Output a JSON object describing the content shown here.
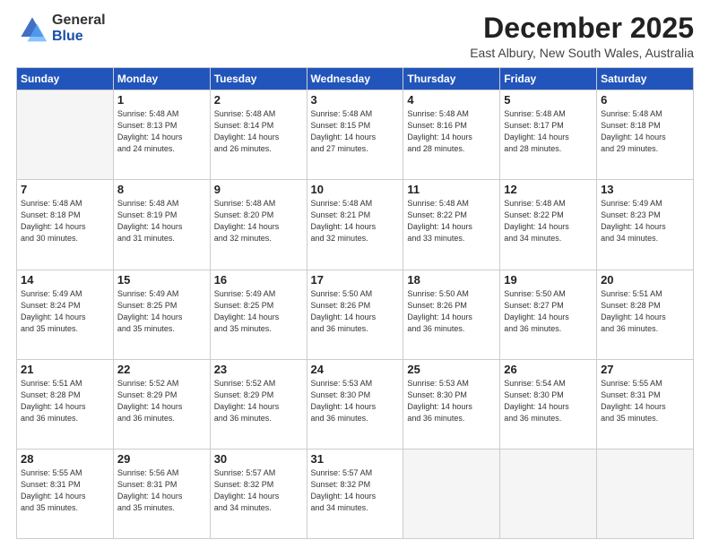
{
  "header": {
    "logo_general": "General",
    "logo_blue": "Blue",
    "month_title": "December 2025",
    "location": "East Albury, New South Wales, Australia"
  },
  "days_of_week": [
    "Sunday",
    "Monday",
    "Tuesday",
    "Wednesday",
    "Thursday",
    "Friday",
    "Saturday"
  ],
  "weeks": [
    [
      {
        "day": "",
        "lines": []
      },
      {
        "day": "1",
        "lines": [
          "Sunrise: 5:48 AM",
          "Sunset: 8:13 PM",
          "Daylight: 14 hours",
          "and 24 minutes."
        ]
      },
      {
        "day": "2",
        "lines": [
          "Sunrise: 5:48 AM",
          "Sunset: 8:14 PM",
          "Daylight: 14 hours",
          "and 26 minutes."
        ]
      },
      {
        "day": "3",
        "lines": [
          "Sunrise: 5:48 AM",
          "Sunset: 8:15 PM",
          "Daylight: 14 hours",
          "and 27 minutes."
        ]
      },
      {
        "day": "4",
        "lines": [
          "Sunrise: 5:48 AM",
          "Sunset: 8:16 PM",
          "Daylight: 14 hours",
          "and 28 minutes."
        ]
      },
      {
        "day": "5",
        "lines": [
          "Sunrise: 5:48 AM",
          "Sunset: 8:17 PM",
          "Daylight: 14 hours",
          "and 28 minutes."
        ]
      },
      {
        "day": "6",
        "lines": [
          "Sunrise: 5:48 AM",
          "Sunset: 8:18 PM",
          "Daylight: 14 hours",
          "and 29 minutes."
        ]
      }
    ],
    [
      {
        "day": "7",
        "lines": [
          "Sunrise: 5:48 AM",
          "Sunset: 8:18 PM",
          "Daylight: 14 hours",
          "and 30 minutes."
        ]
      },
      {
        "day": "8",
        "lines": [
          "Sunrise: 5:48 AM",
          "Sunset: 8:19 PM",
          "Daylight: 14 hours",
          "and 31 minutes."
        ]
      },
      {
        "day": "9",
        "lines": [
          "Sunrise: 5:48 AM",
          "Sunset: 8:20 PM",
          "Daylight: 14 hours",
          "and 32 minutes."
        ]
      },
      {
        "day": "10",
        "lines": [
          "Sunrise: 5:48 AM",
          "Sunset: 8:21 PM",
          "Daylight: 14 hours",
          "and 32 minutes."
        ]
      },
      {
        "day": "11",
        "lines": [
          "Sunrise: 5:48 AM",
          "Sunset: 8:22 PM",
          "Daylight: 14 hours",
          "and 33 minutes."
        ]
      },
      {
        "day": "12",
        "lines": [
          "Sunrise: 5:48 AM",
          "Sunset: 8:22 PM",
          "Daylight: 14 hours",
          "and 34 minutes."
        ]
      },
      {
        "day": "13",
        "lines": [
          "Sunrise: 5:49 AM",
          "Sunset: 8:23 PM",
          "Daylight: 14 hours",
          "and 34 minutes."
        ]
      }
    ],
    [
      {
        "day": "14",
        "lines": [
          "Sunrise: 5:49 AM",
          "Sunset: 8:24 PM",
          "Daylight: 14 hours",
          "and 35 minutes."
        ]
      },
      {
        "day": "15",
        "lines": [
          "Sunrise: 5:49 AM",
          "Sunset: 8:25 PM",
          "Daylight: 14 hours",
          "and 35 minutes."
        ]
      },
      {
        "day": "16",
        "lines": [
          "Sunrise: 5:49 AM",
          "Sunset: 8:25 PM",
          "Daylight: 14 hours",
          "and 35 minutes."
        ]
      },
      {
        "day": "17",
        "lines": [
          "Sunrise: 5:50 AM",
          "Sunset: 8:26 PM",
          "Daylight: 14 hours",
          "and 36 minutes."
        ]
      },
      {
        "day": "18",
        "lines": [
          "Sunrise: 5:50 AM",
          "Sunset: 8:26 PM",
          "Daylight: 14 hours",
          "and 36 minutes."
        ]
      },
      {
        "day": "19",
        "lines": [
          "Sunrise: 5:50 AM",
          "Sunset: 8:27 PM",
          "Daylight: 14 hours",
          "and 36 minutes."
        ]
      },
      {
        "day": "20",
        "lines": [
          "Sunrise: 5:51 AM",
          "Sunset: 8:28 PM",
          "Daylight: 14 hours",
          "and 36 minutes."
        ]
      }
    ],
    [
      {
        "day": "21",
        "lines": [
          "Sunrise: 5:51 AM",
          "Sunset: 8:28 PM",
          "Daylight: 14 hours",
          "and 36 minutes."
        ]
      },
      {
        "day": "22",
        "lines": [
          "Sunrise: 5:52 AM",
          "Sunset: 8:29 PM",
          "Daylight: 14 hours",
          "and 36 minutes."
        ]
      },
      {
        "day": "23",
        "lines": [
          "Sunrise: 5:52 AM",
          "Sunset: 8:29 PM",
          "Daylight: 14 hours",
          "and 36 minutes."
        ]
      },
      {
        "day": "24",
        "lines": [
          "Sunrise: 5:53 AM",
          "Sunset: 8:30 PM",
          "Daylight: 14 hours",
          "and 36 minutes."
        ]
      },
      {
        "day": "25",
        "lines": [
          "Sunrise: 5:53 AM",
          "Sunset: 8:30 PM",
          "Daylight: 14 hours",
          "and 36 minutes."
        ]
      },
      {
        "day": "26",
        "lines": [
          "Sunrise: 5:54 AM",
          "Sunset: 8:30 PM",
          "Daylight: 14 hours",
          "and 36 minutes."
        ]
      },
      {
        "day": "27",
        "lines": [
          "Sunrise: 5:55 AM",
          "Sunset: 8:31 PM",
          "Daylight: 14 hours",
          "and 35 minutes."
        ]
      }
    ],
    [
      {
        "day": "28",
        "lines": [
          "Sunrise: 5:55 AM",
          "Sunset: 8:31 PM",
          "Daylight: 14 hours",
          "and 35 minutes."
        ]
      },
      {
        "day": "29",
        "lines": [
          "Sunrise: 5:56 AM",
          "Sunset: 8:31 PM",
          "Daylight: 14 hours",
          "and 35 minutes."
        ]
      },
      {
        "day": "30",
        "lines": [
          "Sunrise: 5:57 AM",
          "Sunset: 8:32 PM",
          "Daylight: 14 hours",
          "and 34 minutes."
        ]
      },
      {
        "day": "31",
        "lines": [
          "Sunrise: 5:57 AM",
          "Sunset: 8:32 PM",
          "Daylight: 14 hours",
          "and 34 minutes."
        ]
      },
      {
        "day": "",
        "lines": []
      },
      {
        "day": "",
        "lines": []
      },
      {
        "day": "",
        "lines": []
      }
    ]
  ]
}
